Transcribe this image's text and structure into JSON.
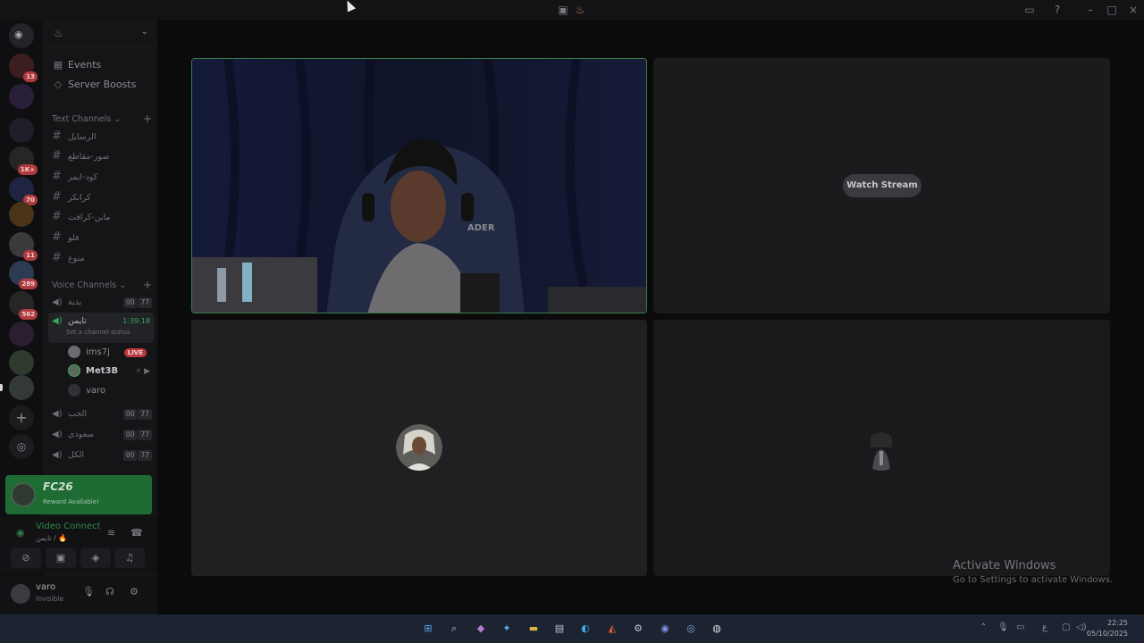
{
  "window": {
    "title_icons": [
      "server-icon",
      "flame-icon"
    ],
    "controls": [
      "minimize",
      "maximize",
      "close"
    ]
  },
  "server": {
    "name_icon": "flame-icon",
    "rail_badges": [
      "13",
      "1K+",
      "70",
      "11",
      "289",
      "562"
    ]
  },
  "sidebar": {
    "nav": [
      {
        "label": "Events",
        "icon": "calendar-icon"
      },
      {
        "label": "Server Boosts",
        "icon": "boost-icon"
      }
    ],
    "text_category": "Text Channels",
    "text_channels": [
      "الرسايل",
      "صور-مقاطع",
      "كود-ايمر",
      "كرانكر",
      "ماين-كرافت",
      "فلو",
      "منوع"
    ],
    "voice_category": "Voice Channels",
    "voice_channels": [
      {
        "name": "بدية",
        "count_a": "00",
        "count_b": "77"
      },
      {
        "name": "تايمن",
        "timer": "1:39:18",
        "status": "Set a channel status",
        "active": true
      },
      {
        "name": "الحب",
        "count_a": "00",
        "count_b": "77"
      },
      {
        "name": "سعودي",
        "count_a": "00",
        "count_b": "77"
      },
      {
        "name": "الكل",
        "count_a": "00",
        "count_b": "77"
      }
    ],
    "members": [
      {
        "name": "ims7j",
        "badge": "LIVE"
      },
      {
        "name": "Met3B"
      },
      {
        "name": "varo"
      }
    ]
  },
  "promo": {
    "title": "FC26",
    "subtitle": "Reward Available!"
  },
  "voice_panel": {
    "title": "Video Connected",
    "subtitle": "تايمن / 🔥"
  },
  "user": {
    "name": "varo",
    "status": "Invisible"
  },
  "stage": {
    "watch_stream": "Watch Stream",
    "activation_title": "Activate Windows",
    "activation_sub": "Go to Settings to activate Windows."
  },
  "taskbar": {
    "time": "22:25",
    "date": "05/10/2025",
    "lang": "ع"
  },
  "colors": {
    "accent_green": "#3ba55c",
    "live_red": "#b93a3e",
    "promo_green": "#1f6b34"
  }
}
